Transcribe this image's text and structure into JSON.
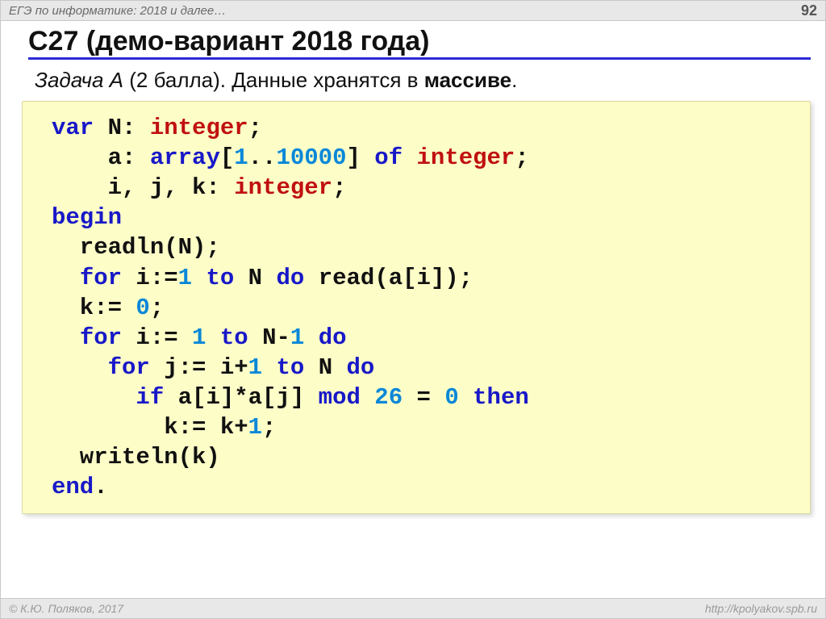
{
  "header": {
    "breadcrumb": "ЕГЭ по информатике: 2018 и далее…",
    "page_number": "92"
  },
  "title": "С27 (демо-вариант 2018 года)",
  "subtitle": {
    "task_label": "Задача А",
    "score": " (2 балла). ",
    "text1": "Данные хранятся в ",
    "bold": "массиве",
    "text2": "."
  },
  "code": {
    "l1_var": "var",
    "l1_rest": " N: ",
    "l1_type": "integer",
    "l1_semi": ";",
    "l2_a": "    a: ",
    "l2_kw": "array",
    "l2_b": "[",
    "l2_n1": "1",
    "l2_dots": "..",
    "l2_n2": "10000",
    "l2_c": "] ",
    "l2_of": "of",
    "l2_d": " ",
    "l2_type": "integer",
    "l2_semi": ";",
    "l3_a": "    i, j, k: ",
    "l3_type": "integer",
    "l3_semi": ";",
    "l4_begin": "begin",
    "l5": "  readln(N);",
    "l6_a": "  ",
    "l6_for": "for",
    "l6_b": " i:=",
    "l6_n": "1",
    "l6_c": " ",
    "l6_to": "to",
    "l6_d": " N ",
    "l6_do": "do",
    "l6_e": " read(a[i]);",
    "l7_a": "  k:= ",
    "l7_n": "0",
    "l7_b": ";",
    "l8_a": "  ",
    "l8_for": "for",
    "l8_b": " i:= ",
    "l8_n": "1",
    "l8_c": " ",
    "l8_to": "to",
    "l8_d": " N-",
    "l8_n2": "1",
    "l8_e": " ",
    "l8_do": "do",
    "l9_a": "    ",
    "l9_for": "for",
    "l9_b": " j:= i+",
    "l9_n": "1",
    "l9_c": " ",
    "l9_to": "to",
    "l9_d": " N ",
    "l9_do": "do",
    "l10_a": "      ",
    "l10_if": "if",
    "l10_b": " a[i]*a[j] ",
    "l10_mod": "mod",
    "l10_c": " ",
    "l10_n1": "26",
    "l10_d": " = ",
    "l10_n2": "0",
    "l10_e": " ",
    "l10_then": "then",
    "l11_a": "        k:= k+",
    "l11_n": "1",
    "l11_b": ";",
    "l12": "  writeln(k)",
    "l13_end": "end",
    "l13_dot": "."
  },
  "footer": {
    "copyright": "© К.Ю. Поляков, 2017",
    "url": "http://kpolyakov.spb.ru"
  }
}
